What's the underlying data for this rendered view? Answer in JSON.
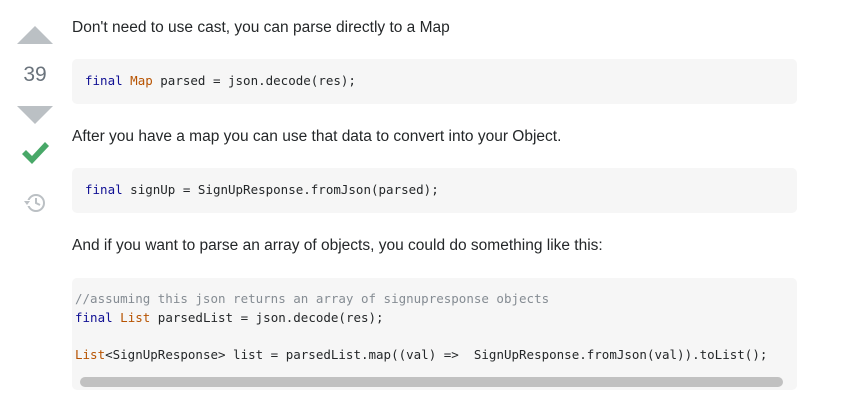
{
  "vote": {
    "count": "39",
    "upvote_icon": "triangle-up-icon",
    "downvote_icon": "triangle-down-icon",
    "accepted_icon": "checkmark-icon",
    "history_icon": "history-icon",
    "colors": {
      "arrow": "#bbc0c4",
      "count": "#6a737c",
      "accepted": "#48a868",
      "history": "#bbc0c4"
    }
  },
  "answer": {
    "para1": "Don't need to use cast, you can parse directly to a Map",
    "code1": {
      "kw": "final",
      "type": "Map",
      "rest": " parsed = json.decode(res);"
    },
    "para2": "After you have a map you can use that data to convert into your Object.",
    "code2": {
      "kw": "final",
      "rest": " signUp = SignUpResponse.fromJson(parsed);"
    },
    "para3": "And if you want to parse an array of objects, you could do something like this:",
    "code3": {
      "comment": "//assuming this json returns an array of signupresponse objects",
      "line2_kw": "final",
      "line2_type": "List",
      "line2_rest": " parsedList = json.decode(res);",
      "line3_type": "List",
      "line3_rest": "<SignUpResponse> list = parsedList.map((val) =>  SignUpResponse.fromJson(val)).toList();"
    }
  }
}
